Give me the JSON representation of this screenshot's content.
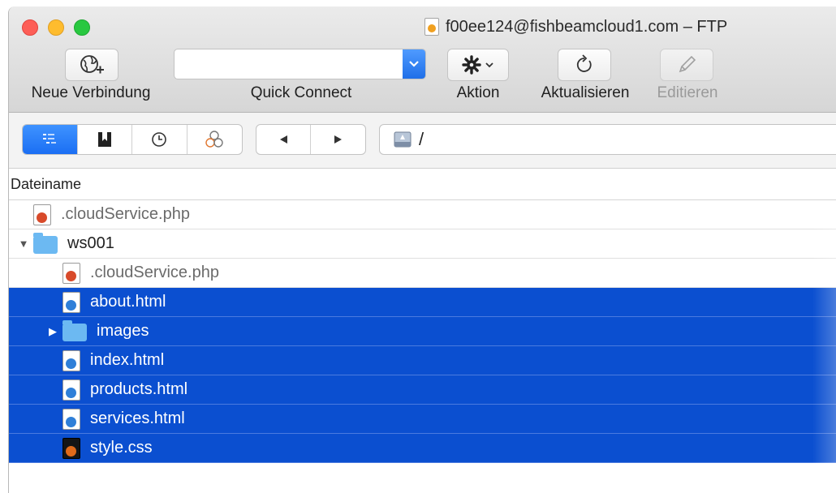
{
  "window": {
    "title": "f00ee124@fishbeamcloud1.com – FTP"
  },
  "toolbar": {
    "new_connection_label": "Neue Verbindung",
    "quick_connect_label": "Quick Connect",
    "quick_connect_value": "",
    "action_label": "Aktion",
    "refresh_label": "Aktualisieren",
    "edit_label": "Editieren"
  },
  "navbar": {
    "view_modes": [
      "list-view-icon",
      "bookmarks-icon",
      "history-icon",
      "bonjour-icon"
    ],
    "active_view": "list-view-icon",
    "back_icon": "back-arrow-icon",
    "forward_icon": "forward-arrow-icon",
    "path": "/"
  },
  "file_list": {
    "column_header": "Dateiname",
    "rows": [
      {
        "name": ".cloudService.php",
        "type": "php",
        "indent": 0,
        "selected": false
      },
      {
        "name": "ws001",
        "type": "folder",
        "indent": 0,
        "expanded": true,
        "selected": false
      },
      {
        "name": ".cloudService.php",
        "type": "php",
        "indent": 1,
        "selected": false
      },
      {
        "name": "about.html",
        "type": "html",
        "indent": 1,
        "selected": true
      },
      {
        "name": "images",
        "type": "folder",
        "indent": 1,
        "expanded": false,
        "selected": true
      },
      {
        "name": "index.html",
        "type": "html",
        "indent": 1,
        "selected": true
      },
      {
        "name": "products.html",
        "type": "html",
        "indent": 1,
        "selected": true
      },
      {
        "name": "services.html",
        "type": "html",
        "indent": 1,
        "selected": true
      },
      {
        "name": "style.css",
        "type": "css",
        "indent": 1,
        "selected": true
      }
    ]
  },
  "colors": {
    "selection": "#0b4fd0",
    "accent": "#1b6ef3",
    "folder": "#6cb9f2"
  }
}
